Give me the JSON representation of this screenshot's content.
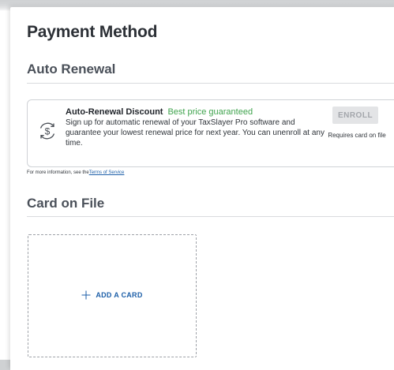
{
  "page": {
    "title": "Payment Method"
  },
  "auto_renewal": {
    "section_title": "Auto Renewal",
    "heading": "Auto-Renewal Discount",
    "highlight": "Best price guaranteed",
    "description": "Sign up for automatic renewal of your TaxSlayer Pro software and guarantee your lowest renewal price for next year. You can unenroll at any time.",
    "enroll_label": "ENROLL",
    "enroll_note": "Requires card on file",
    "icon": "dollar-refresh-icon"
  },
  "info": {
    "prefix": "For more information, see the",
    "link_text": "Terms of Service"
  },
  "card_on_file": {
    "section_title": "Card on File",
    "add_card_label": "ADD A CARD",
    "icon": "plus-icon"
  },
  "colors": {
    "accent_blue": "#1d5fa8",
    "success_green": "#3fa34d",
    "disabled_button": "#e3e4e6"
  }
}
